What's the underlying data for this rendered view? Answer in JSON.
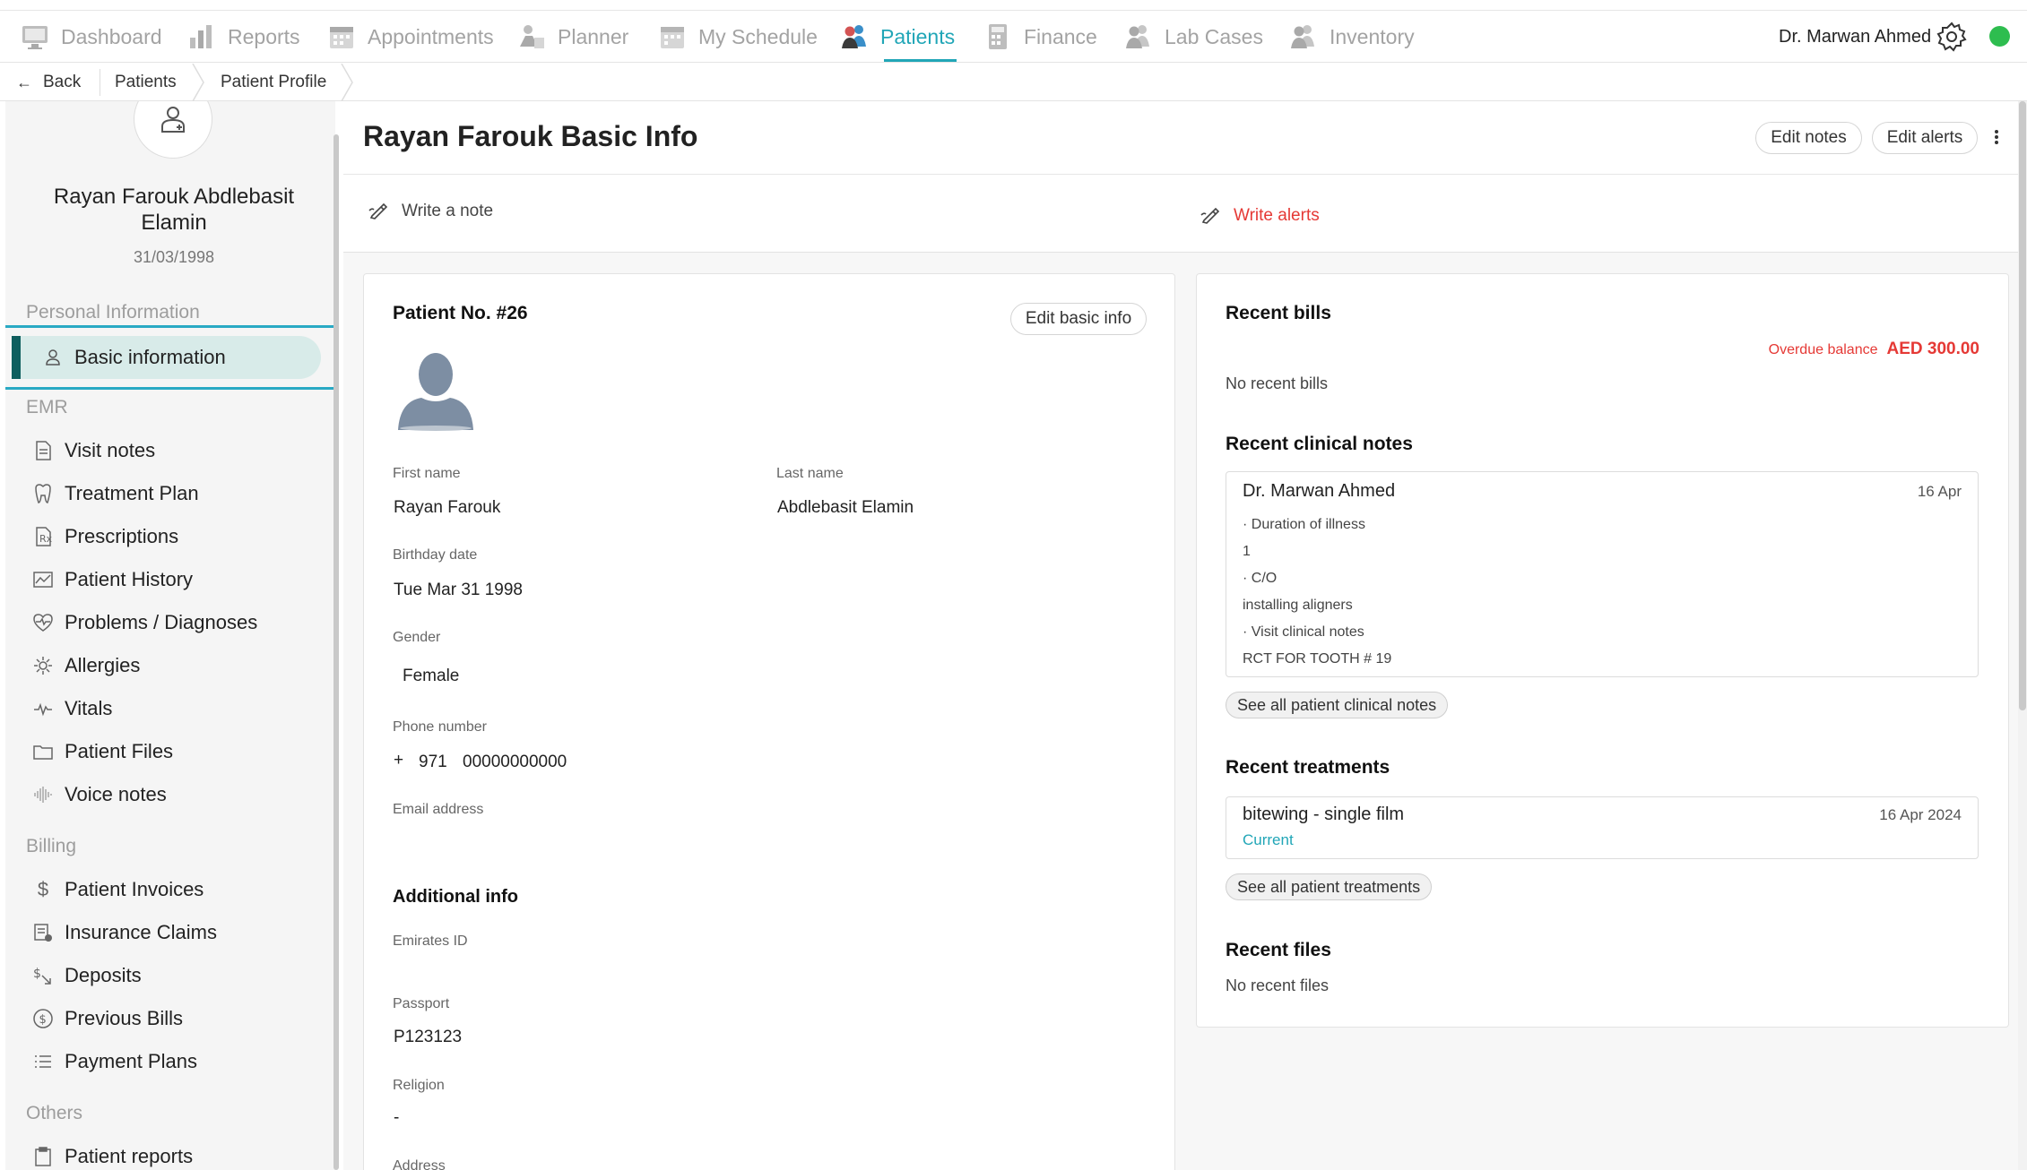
{
  "nav": {
    "items": [
      {
        "label": "Dashboard",
        "icon": "monitor-icon"
      },
      {
        "label": "Reports",
        "icon": "bar-chart-icon"
      },
      {
        "label": "Appointments",
        "icon": "calendar-icon"
      },
      {
        "label": "Planner",
        "icon": "planner-icon"
      },
      {
        "label": "My Schedule",
        "icon": "schedule-icon"
      },
      {
        "label": "Patients",
        "icon": "patients-icon"
      },
      {
        "label": "Finance",
        "icon": "calculator-icon"
      },
      {
        "label": "Lab Cases",
        "icon": "lab-icon"
      },
      {
        "label": "Inventory",
        "icon": "inventory-icon"
      }
    ],
    "active": "Patients",
    "user_name": "Dr. Marwan Ahmed",
    "status_color": "#2ebd4f",
    "accent_color": "#21a6b7"
  },
  "breadcrumb": {
    "back": "Back",
    "items": [
      "Patients",
      "Patient Profile"
    ]
  },
  "sidebar": {
    "patient_name": "Rayan Farouk Abdlebasit Elamin",
    "patient_dob": "31/03/1998",
    "sections": {
      "personal": "Personal Information",
      "emr": "EMR",
      "billing": "Billing",
      "others": "Others"
    },
    "active_item": "Basic information",
    "emr_items": [
      "Visit notes",
      "Treatment Plan",
      "Prescriptions",
      "Patient History",
      "Problems / Diagnoses",
      "Allergies",
      "Vitals",
      "Patient Files",
      "Voice notes"
    ],
    "billing_items": [
      "Patient Invoices",
      "Insurance Claims",
      "Deposits",
      "Previous Bills",
      "Payment Plans"
    ],
    "others_items": [
      "Patient reports"
    ]
  },
  "header": {
    "title": "Rayan Farouk Basic Info",
    "edit_notes": "Edit notes",
    "edit_alerts": "Edit alerts",
    "write_note": "Write a note",
    "write_alerts": "Write alerts",
    "alert_color": "#e53935"
  },
  "basic": {
    "patient_no": "Patient No. #26",
    "edit_basic_info": "Edit basic info",
    "first_name_label": "First name",
    "first_name": "Rayan Farouk",
    "last_name_label": "Last name",
    "last_name": "Abdlebasit Elamin",
    "birthday_label": "Birthday date",
    "birthday": "Tue Mar 31 1998",
    "gender_label": "Gender",
    "gender": "Female",
    "phone_label": "Phone number",
    "phone_plus": "+",
    "phone_code": "971",
    "phone_number": "00000000000",
    "email_label": "Email address",
    "email": "",
    "additional_title": "Additional info",
    "emirates_label": "Emirates ID",
    "emirates": "",
    "passport_label": "Passport",
    "passport": "P123123",
    "religion_label": "Religion",
    "religion": "-",
    "address_label": "Address"
  },
  "summary": {
    "recent_bills_title": "Recent bills",
    "overdue_label": "Overdue balance",
    "overdue_amount": "AED 300.00",
    "no_bills": "No recent bills",
    "clinical_title": "Recent clinical notes",
    "clinical_note": {
      "doctor": "Dr. Marwan Ahmed",
      "date": "16 Apr",
      "lines": [
        "· Duration of illness",
        "1",
        "· C/O",
        "installing aligners",
        "· Visit clinical notes",
        "RCT FOR TOOTH # 19"
      ]
    },
    "see_all_clinical": "See all patient clinical notes",
    "treatments_title": "Recent treatments",
    "treatment": {
      "name": "bitewing - single film",
      "date": "16 Apr 2024",
      "status": "Current"
    },
    "see_all_treatments": "See all patient treatments",
    "files_title": "Recent files",
    "no_files": "No recent files"
  }
}
